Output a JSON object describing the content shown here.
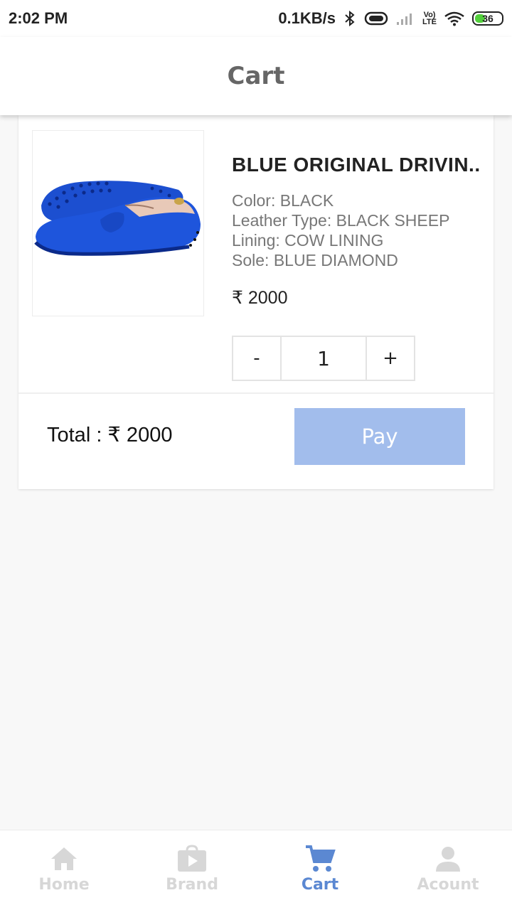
{
  "status_bar": {
    "time": "2:02 PM",
    "speed": "0.1KB/s",
    "vo_label": "Vo)",
    "lte_label": "LTE",
    "battery": "36",
    "battery_color": "#53d03c"
  },
  "header": {
    "title": "Cart"
  },
  "cart": {
    "item": {
      "name": "BLUE ORIGINAL DRIVIN...",
      "attributes": [
        "Color: BLACK",
        "Leather Type: BLACK SHEEP",
        "Lining: COW LINING",
        "Sole: BLUE DIAMOND"
      ],
      "price": "₹ 2000",
      "quantity": "1",
      "minus_label": "-",
      "plus_label": "+",
      "image_icon": "blue-driving-loafer-shoe"
    },
    "total_label": "Total : ₹ 2000",
    "pay_label": "Pay",
    "pay_color": "#a2bdec"
  },
  "bottom_nav": {
    "active_color": "#5b88d2",
    "inactive_color": "#d7d7d7",
    "items": [
      {
        "label": "Home",
        "icon": "home-icon"
      },
      {
        "label": "Brand",
        "icon": "play-bag-icon"
      },
      {
        "label": "Cart",
        "icon": "cart-icon",
        "active": true
      },
      {
        "label": "Acount",
        "icon": "person-icon"
      }
    ]
  }
}
